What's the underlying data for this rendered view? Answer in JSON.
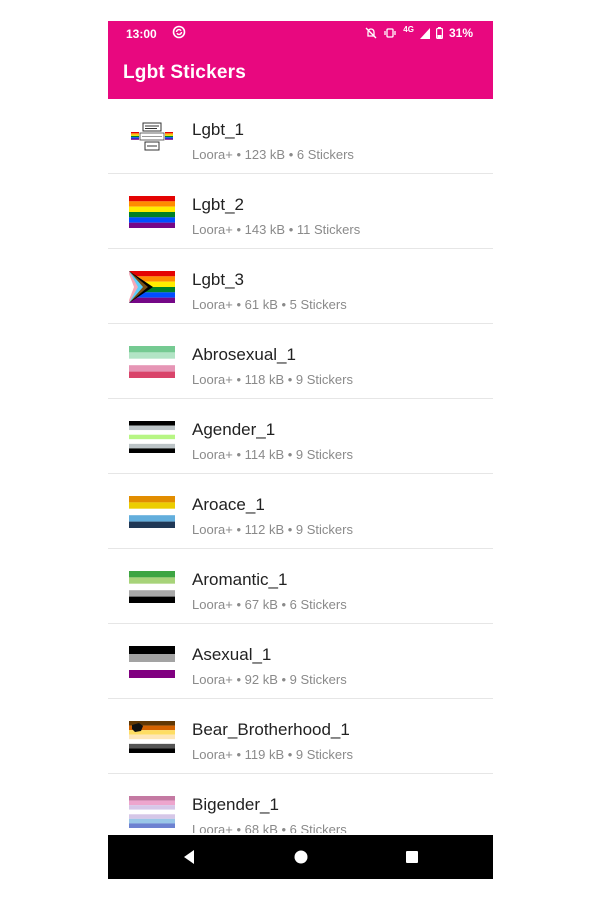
{
  "status_bar": {
    "time": "13:00",
    "network": "4G",
    "battery": "31%",
    "icons": [
      "sync-icon",
      "mute-icon",
      "vibrate-icon",
      "signal-icon",
      "battery-icon"
    ]
  },
  "app_bar": {
    "title": "Lgbt Stickers",
    "color": "#e8087f"
  },
  "packs": [
    {
      "name": "Lgbt_1",
      "meta": "Loora+ • 123 kB • 6 Stickers",
      "icon": "happy-pride-day-icon"
    },
    {
      "name": "Lgbt_2",
      "meta": "Loora+ • 143 kB • 11 Stickers",
      "icon": "rainbow-flag-icon"
    },
    {
      "name": "Lgbt_3",
      "meta": "Loora+ • 61 kB • 5 Stickers",
      "icon": "progress-pride-flag-icon"
    },
    {
      "name": "Abrosexual_1",
      "meta": "Loora+ • 118 kB • 9 Stickers",
      "icon": "abrosexual-flag-icon"
    },
    {
      "name": "Agender_1",
      "meta": "Loora+ • 114 kB • 9 Stickers",
      "icon": "agender-flag-icon"
    },
    {
      "name": "Aroace_1",
      "meta": "Loora+ • 112 kB • 9 Stickers",
      "icon": "aroace-flag-icon"
    },
    {
      "name": "Aromantic_1",
      "meta": "Loora+ • 67 kB • 6 Stickers",
      "icon": "aromantic-flag-icon"
    },
    {
      "name": "Asexual_1",
      "meta": "Loora+ • 92 kB • 9 Stickers",
      "icon": "asexual-flag-icon"
    },
    {
      "name": "Bear_Brotherhood_1",
      "meta": "Loora+ • 119 kB • 9 Stickers",
      "icon": "bear-brotherhood-flag-icon"
    },
    {
      "name": "Bigender_1",
      "meta": "Loora+ • 68 kB • 6 Stickers",
      "icon": "bigender-flag-icon"
    }
  ],
  "nav_bar": {
    "buttons": [
      "back-icon",
      "home-icon",
      "recents-icon"
    ]
  }
}
